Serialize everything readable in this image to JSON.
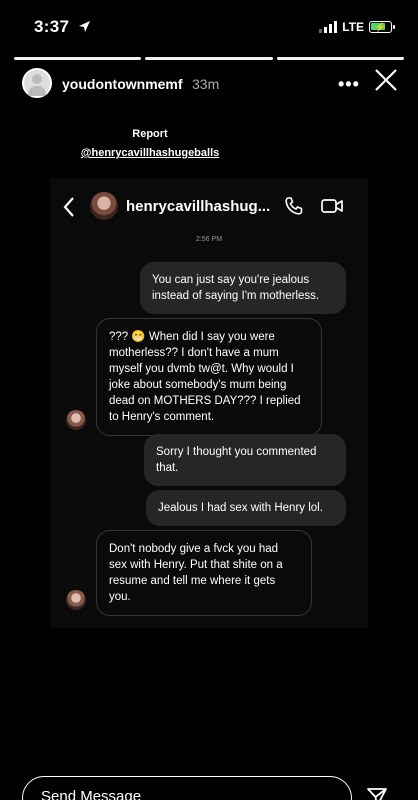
{
  "status_bar": {
    "time": "3:37",
    "network": "LTE"
  },
  "story": {
    "username": "youdontownmemf",
    "time_ago": "33m",
    "more": "•••"
  },
  "report": {
    "title": "Report",
    "handle": "@henrycavillhashugeballs"
  },
  "dm": {
    "contact_name": "henrycavillhashug...",
    "timestamp": "2:56 PM",
    "messages": [
      {
        "from": "me",
        "text": "You can just say you're jealous instead of saying I'm motherless."
      },
      {
        "from": "them",
        "text": "??? 😁 When did I say you were motherless?? I don't have a mum myself you dvmb tw@t. Why would I joke about somebody's mum being dead on MOTHERS DAY??? I replied to Henry's comment."
      },
      {
        "from": "me",
        "text": "Sorry I thought you commented that."
      },
      {
        "from": "me",
        "text": "Jealous I had sex with Henry lol."
      },
      {
        "from": "them",
        "text": "Don't nobody give a fvck you had sex with Henry. Put that shite on a resume and tell me where it gets you."
      }
    ]
  },
  "composer": {
    "placeholder": "Send Message"
  },
  "colors": {
    "background": "#000000",
    "bubble_sent": "#262626",
    "bubble_received_border": "#363636",
    "battery": "#4cd964"
  },
  "icons": [
    "location-arrow-icon",
    "signal-icon",
    "battery-icon",
    "more-icon",
    "close-icon",
    "back-icon",
    "phone-icon",
    "video-icon",
    "send-icon"
  ]
}
